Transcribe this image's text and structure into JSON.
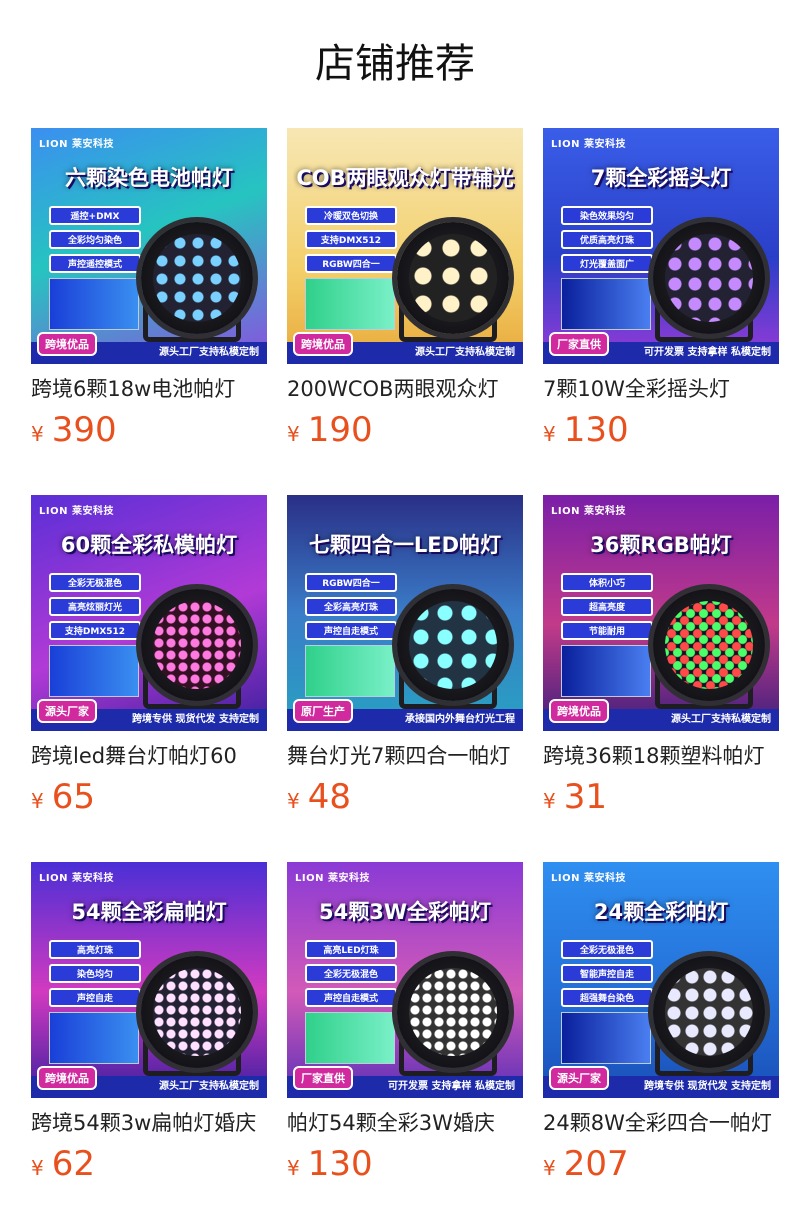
{
  "page": {
    "title": "店铺推荐"
  },
  "theme": {
    "price_color": "#e8501e",
    "text_color": "#222222"
  },
  "products": [
    {
      "name": "跨境6颗18w电池帕灯",
      "currency": "¥",
      "price": "390",
      "image": {
        "logo": "LION 莱安科技",
        "headline": "六颗染色电池帕灯",
        "tags": [
          "遥控+DMX",
          "全彩均匀染色",
          "声控遥控模式"
        ],
        "badge": "跨境优品",
        "footer": "源头工厂支持私模定制",
        "bg": "linear-gradient(160deg,#3b8ff0 0%,#26c4c0 45%,#8b4fe0 100%)",
        "fixture_icon": "battery-par-light"
      }
    },
    {
      "name": "200WCOB两眼观众灯",
      "currency": "¥",
      "price": "190",
      "image": {
        "logo": "",
        "headline": "COB两眼观众灯带辅光",
        "tags": [
          "冷暖双色切换",
          "支持DMX512",
          "RGBW四合一"
        ],
        "badge": "跨境优品",
        "footer": "源头工厂支持私模定制",
        "bg": "linear-gradient(180deg,#f7e7b4 0%,#f3cf6a 60%,#e8a93a 100%)",
        "fixture_icon": "cob-audience-blinder"
      }
    },
    {
      "name": "7颗10W全彩摇头灯",
      "currency": "¥",
      "price": "130",
      "image": {
        "logo": "LION 莱安科技",
        "headline": "7颗全彩摇头灯",
        "tags": [
          "染色效果均匀",
          "优质高亮灯珠",
          "灯光覆盖面广"
        ],
        "badge": "厂家直供",
        "footer": "可开发票 支持拿样 私模定制",
        "bg": "linear-gradient(180deg,#3a5ee8 0%,#2a3fc8 55%,#9a3ad8 100%)",
        "fixture_icon": "moving-head-light"
      }
    },
    {
      "name": "跨境led舞台灯帕灯60",
      "currency": "¥",
      "price": "65",
      "image": {
        "logo": "LION 莱安科技",
        "headline": "60颗全彩私模帕灯",
        "tags": [
          "全彩无极混色",
          "高亮炫丽灯光",
          "支持DMX512"
        ],
        "badge": "源头厂家",
        "footer": "跨境专供 现货代发 支持定制",
        "bg": "linear-gradient(160deg,#5a2fd6 0%,#b23ad6 55%,#3a1f9c 100%)",
        "fixture_icon": "par-light-pink"
      }
    },
    {
      "name": "舞台灯光7颗四合一帕灯",
      "currency": "¥",
      "price": "48",
      "image": {
        "logo": "",
        "headline": "七颗四合一LED帕灯",
        "tags": [
          "RGBW四合一",
          "全彩高亮灯珠",
          "声控自走模式"
        ],
        "badge": "原厂生产",
        "footer": "承接国内外舞台灯光工程",
        "bg": "linear-gradient(180deg,#2a2f86 0%,#3a7cc8 50%,#27a3c2 100%)",
        "fixture_icon": "par-light-cyan"
      }
    },
    {
      "name": "跨境36颗18颗塑料帕灯",
      "currency": "¥",
      "price": "31",
      "image": {
        "logo": "LION 莱安科技",
        "headline": "36颗RGB帕灯",
        "tags": [
          "体积小巧",
          "超高亮度",
          "节能耐用"
        ],
        "badge": "跨境优品",
        "footer": "源头工厂支持私模定制",
        "bg": "linear-gradient(180deg,#7a1fa8 0%,#c23a8a 55%,#3a1f7c 100%)",
        "fixture_icon": "par-light-rgb"
      }
    },
    {
      "name": "跨境54颗3w扁帕灯婚庆",
      "currency": "¥",
      "price": "62",
      "image": {
        "logo": "LION 莱安科技",
        "headline": "54颗全彩扁帕灯",
        "tags": [
          "高亮灯珠",
          "染色均匀",
          "声控自走"
        ],
        "badge": "跨境优品",
        "footer": "源头工厂支持私模定制",
        "bg": "linear-gradient(180deg,#4a2fd6 0%,#d23ac0 55%,#3a1fa0 100%)",
        "fixture_icon": "flat-par-light"
      }
    },
    {
      "name": "帕灯54颗全彩3W婚庆",
      "currency": "¥",
      "price": "130",
      "image": {
        "logo": "LION 莱安科技",
        "headline": "54颗3W全彩帕灯",
        "tags": [
          "高亮LED灯珠",
          "全彩无极混色",
          "声控自走模式"
        ],
        "badge": "厂家直供",
        "footer": "可开发票 支持拿样 私模定制",
        "bg": "linear-gradient(180deg,#8a3ad6 0%,#d25ab8 55%,#5a2fb8 100%)",
        "fixture_icon": "par-light-white"
      }
    },
    {
      "name": "24颗8W全彩四合一帕灯",
      "currency": "¥",
      "price": "207",
      "image": {
        "logo": "LION 莱安科技",
        "headline": "24颗全彩帕灯",
        "tags": [
          "全彩无极混色",
          "智能声控自走",
          "超强舞台染色"
        ],
        "badge": "源头厂家",
        "footer": "跨境专供 现货代发 支持定制",
        "bg": "linear-gradient(180deg,#2f8ff0 0%,#2470d8 55%,#1a4fb8 100%)",
        "fixture_icon": "par-light-blue"
      }
    }
  ]
}
